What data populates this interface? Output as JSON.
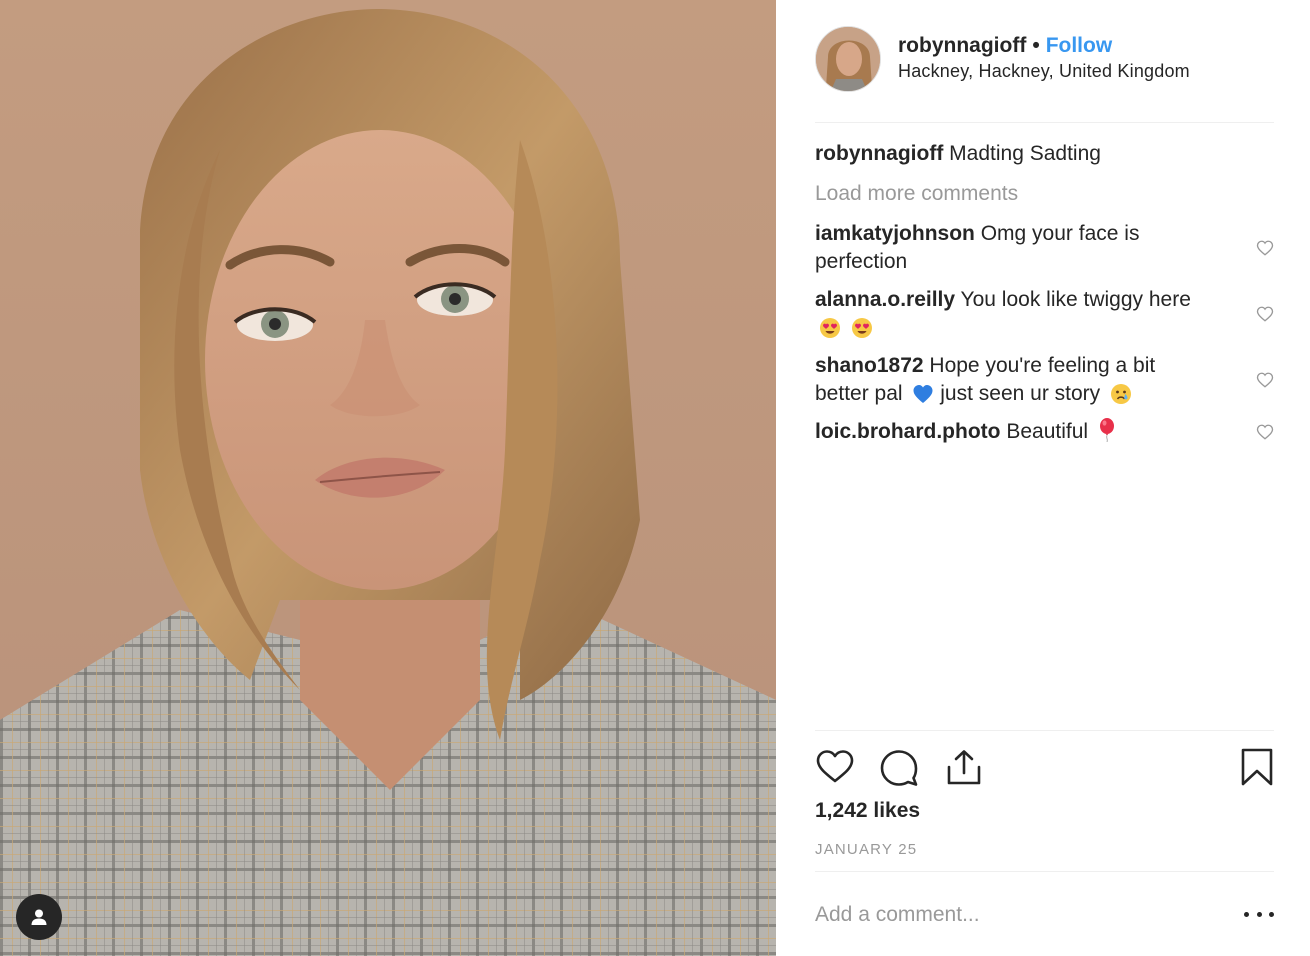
{
  "post": {
    "photo_alt": "Portrait photo",
    "tag_icon": "user-silhouette-icon"
  },
  "header": {
    "username": "robynnagioff",
    "separator": "•",
    "follow_label": "Follow",
    "location": "Hackney, Hackney, United Kingdom"
  },
  "caption": {
    "username": "robynnagioff",
    "text": "Madting Sadting"
  },
  "load_more_label": "Load more comments",
  "comments": [
    {
      "username": "iamkatyjohnson",
      "text": "Omg your face is perfection",
      "emojis": []
    },
    {
      "username": "alanna.o.reilly",
      "text": "You look like twiggy here",
      "emojis": [
        "heart-eyes-emoji",
        "heart-eyes-emoji"
      ]
    },
    {
      "username": "shano1872",
      "text_a": "Hope you're feeling a bit better pal",
      "text_b": "just seen ur story",
      "emojis": [
        "blue-heart-emoji",
        "crying-face-emoji"
      ]
    },
    {
      "username": "loic.brohard.photo",
      "text": "Beautiful",
      "emojis": [
        "balloon-emoji"
      ]
    }
  ],
  "actions": {
    "like_icon": "heart-icon",
    "comment_icon": "comment-bubble-icon",
    "share_icon": "share-upload-icon",
    "save_icon": "bookmark-icon"
  },
  "likes_text": "1,242 likes",
  "date_text": "JANUARY 25",
  "add_comment": {
    "placeholder": "Add a comment...",
    "more_icon": "more-options-icon"
  },
  "colors": {
    "accent": "#3897f0",
    "text": "#262626",
    "muted": "#999999",
    "divider": "#efefef"
  }
}
